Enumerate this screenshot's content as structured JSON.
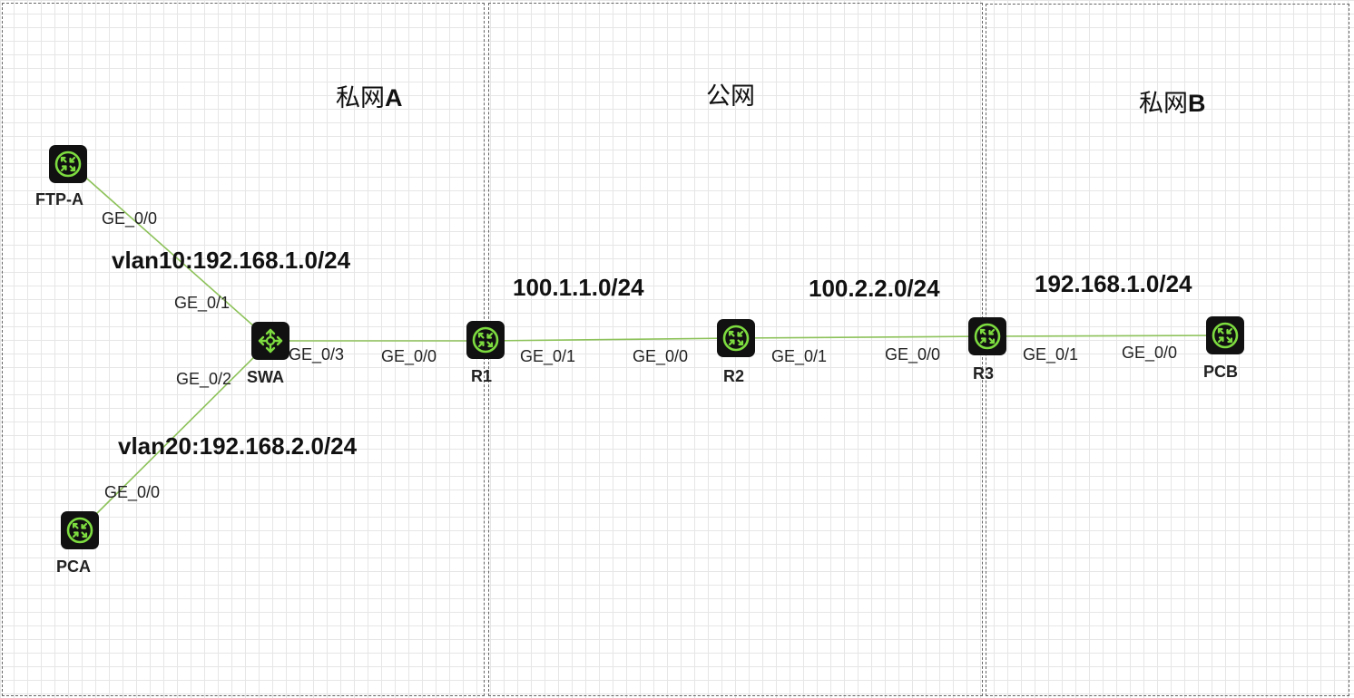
{
  "zones": {
    "private_a": {
      "prefix": "私网",
      "suffix": "A"
    },
    "public": {
      "label": "公网"
    },
    "private_b": {
      "prefix": "私网",
      "suffix": "B"
    }
  },
  "devices": {
    "ftp_a": {
      "label": "FTP-A",
      "icon": "router-icon"
    },
    "swa": {
      "label": "SWA",
      "icon": "switch-icon"
    },
    "pca": {
      "label": "PCA",
      "icon": "router-icon"
    },
    "r1": {
      "label": "R1",
      "icon": "router-icon"
    },
    "r2": {
      "label": "R2",
      "icon": "router-icon"
    },
    "r3": {
      "label": "R3",
      "icon": "router-icon"
    },
    "pcb": {
      "label": "PCB",
      "icon": "router-icon"
    }
  },
  "ports": {
    "ftp_a_ge00": "GE_0/0",
    "swa_ge01": "GE_0/1",
    "swa_ge02": "GE_0/2",
    "pca_ge00": "GE_0/0",
    "swa_ge03": "GE_0/3",
    "r1_ge00": "GE_0/0",
    "r1_ge01": "GE_0/1",
    "r2_ge00": "GE_0/0",
    "r2_ge01": "GE_0/1",
    "r3_ge00": "GE_0/0",
    "r3_ge01": "GE_0/1",
    "pcb_ge00": "GE_0/0"
  },
  "networks": {
    "vlan10": "vlan10:192.168.1.0/24",
    "vlan20": "vlan20:192.168.2.0/24",
    "r1_r2": "100.1.1.0/24",
    "r2_r3": "100.2.2.0/24",
    "r3_pcb": "192.168.1.0/24"
  },
  "colors": {
    "link": "#8dc25a",
    "device_bg": "#111111",
    "device_glyph": "#7ddc3f",
    "zone_border": "#666666"
  }
}
